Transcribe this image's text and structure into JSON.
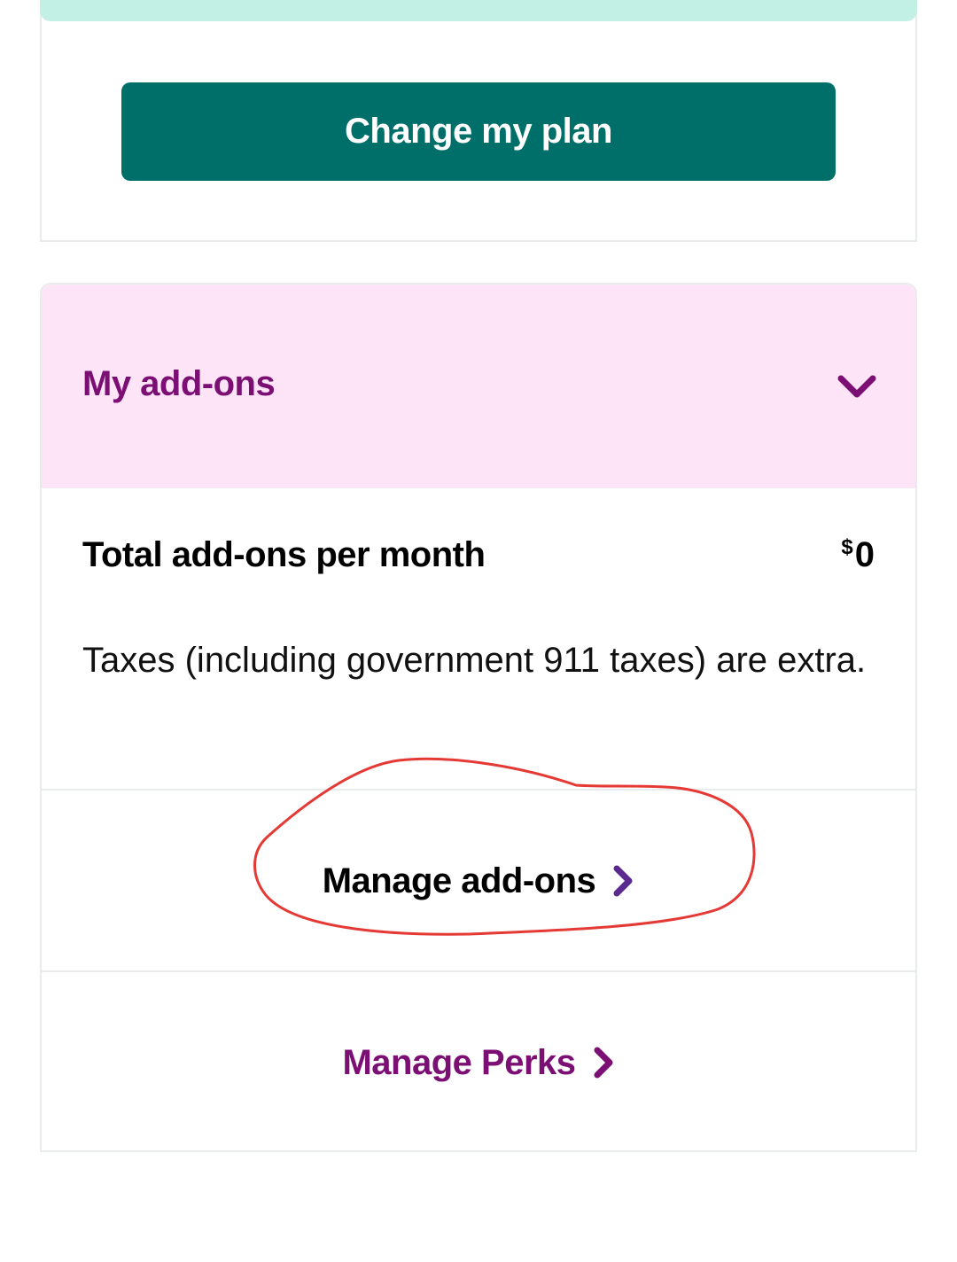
{
  "plan": {
    "change_button_label": "Change my plan",
    "strip_color": "#c3f0e5",
    "button_color": "#006e69"
  },
  "addons": {
    "title": "My add-ons",
    "header_bg": "#fde4f7",
    "accent_color": "#7b0f74",
    "expand_icon": "chevron-down-icon",
    "total_label": "Total add-ons per month",
    "total_currency": "$",
    "total_amount": "0",
    "taxes_note": "Taxes (including government 911 taxes) are extra.",
    "manage_addons_label": "Manage add-ons",
    "manage_perks_label": "Manage Perks",
    "link_icon": "chevron-right-icon"
  },
  "annotation": {
    "type": "hand-drawn circle",
    "color": "#e53935",
    "target": "Manage add-ons"
  }
}
